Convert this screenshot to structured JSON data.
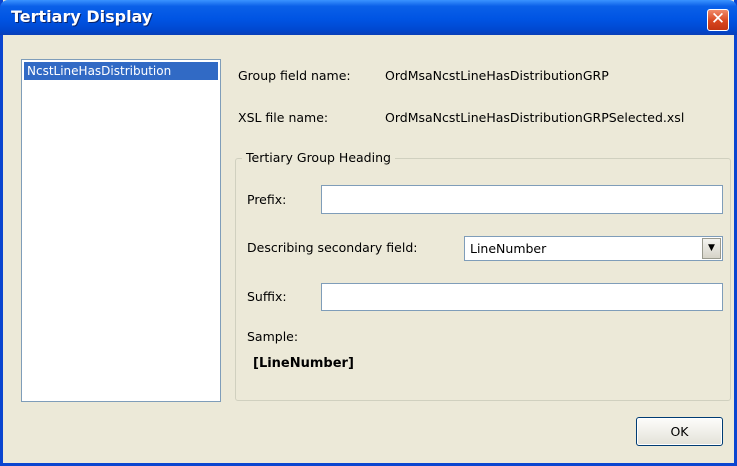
{
  "window": {
    "title": "Tertiary Display",
    "close_glyph": "✕"
  },
  "list": {
    "items": [
      "NcstLineHasDistribution"
    ],
    "selected_index": 0
  },
  "info": {
    "group_field_label": "Group field name:",
    "group_field_value": "OrdMsaNcstLineHasDistributionGRP",
    "xsl_file_label": "XSL file name:",
    "xsl_file_value": "OrdMsaNcstLineHasDistributionGRPSelected.xsl"
  },
  "heading_group": {
    "title": "Tertiary Group Heading",
    "prefix_label": "Prefix:",
    "prefix_value": "",
    "describing_label": "Describing secondary field:",
    "describing_value": "LineNumber",
    "suffix_label": "Suffix:",
    "suffix_value": "",
    "sample_label": "Sample:",
    "sample_value": "[LineNumber]"
  },
  "buttons": {
    "ok_label": "OK"
  },
  "colors": {
    "title_bar": "#0054e3",
    "selection": "#316ac5",
    "dialog_bg": "#ece9d8",
    "close_button": "#d8461f"
  }
}
